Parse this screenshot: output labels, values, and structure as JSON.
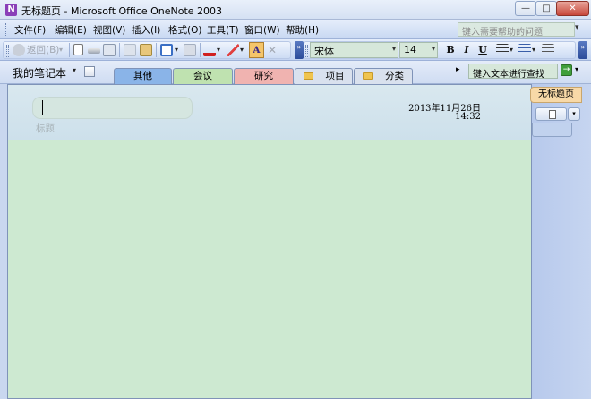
{
  "window": {
    "title": "无标题页 - Microsoft Office OneNote 2003",
    "app_icon_glyph": "N",
    "min_glyph": "—",
    "max_glyph": "□",
    "close_glyph": "✕"
  },
  "menu": {
    "items": [
      "文件(F)",
      "编辑(E)",
      "视图(V)",
      "插入(I)",
      "格式(O)",
      "工具(T)",
      "窗口(W)",
      "帮助(H)"
    ],
    "help_placeholder": "键入需要帮助的问题",
    "dropdown_glyph": "▾"
  },
  "toolbar": {
    "back_label": "返回(B)",
    "font_name": "宋体",
    "font_size": "14",
    "bold_label": "B",
    "italic_label": "I",
    "underline_label": "U",
    "highlight_label": "A",
    "delete_glyph": "✕",
    "dropdown_glyph": "▾",
    "chevron_glyph": "»"
  },
  "notebook": {
    "title": "我的笔记本",
    "caret_glyph": "▾",
    "sections": [
      {
        "label": "其他",
        "color": "#8ab4e8"
      },
      {
        "label": "会议",
        "color": "#bfe2b0"
      },
      {
        "label": "研究",
        "color": "#f0b3b0"
      },
      {
        "label": "项目",
        "color": "#d9e1ee"
      },
      {
        "label": "分类",
        "color": "#d9e1ee"
      }
    ],
    "scroll_arrow": "▸",
    "search_placeholder": "键入文本进行查找",
    "go_glyph": "→",
    "search_dropdown_glyph": "▾"
  },
  "page": {
    "title_hint": "标题",
    "date": "2013年11月26日",
    "time": "14:32",
    "background_color": "#cde9d1"
  },
  "page_list": {
    "active_page": "无标题页",
    "new_page_dropdown_glyph": "▾"
  }
}
